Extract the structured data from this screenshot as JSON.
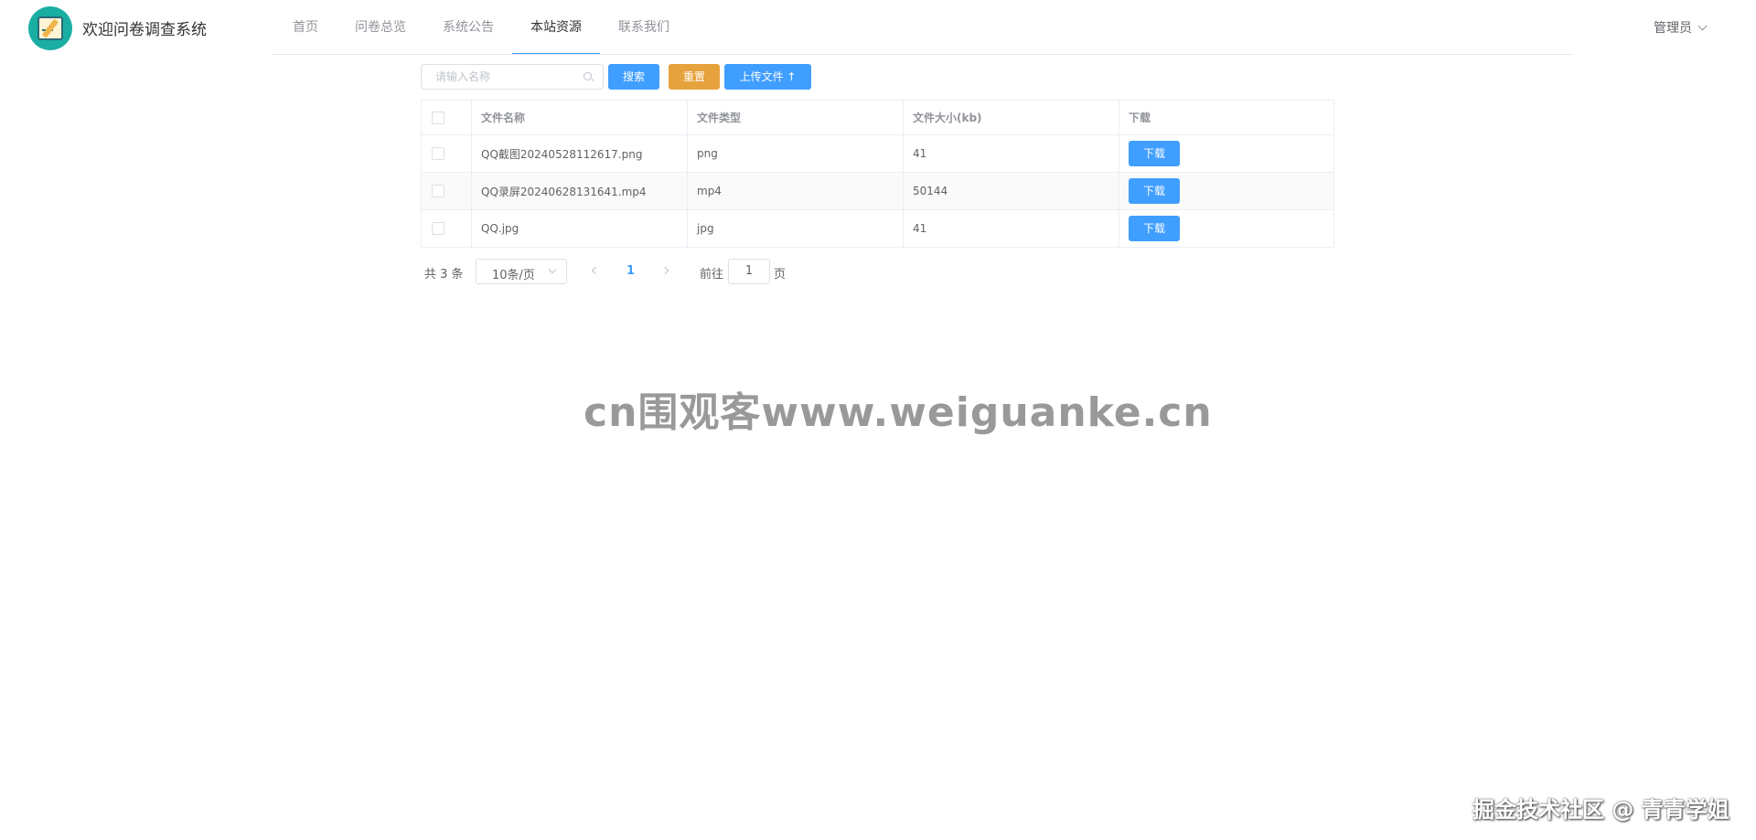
{
  "app": {
    "title": "欢迎问卷调查系统",
    "brand_color": "#1aaea3",
    "accent_color": "#409eff"
  },
  "nav": {
    "items": [
      {
        "label": "首页",
        "active": false
      },
      {
        "label": "问卷总览",
        "active": false
      },
      {
        "label": "系统公告",
        "active": false
      },
      {
        "label": "本站资源",
        "active": true
      },
      {
        "label": "联系我们",
        "active": false
      }
    ]
  },
  "user": {
    "label": "管理员",
    "icon": "chevron-down-icon"
  },
  "toolbar": {
    "search_placeholder": "请输入名称",
    "search_value": "",
    "search_label": "搜索",
    "reset_label": "重置",
    "upload_label": "上传文件 ↑",
    "reset_color": "#e6a23c"
  },
  "table": {
    "columns": [
      "文件名称",
      "文件类型",
      "文件大小(kb)",
      "下载"
    ],
    "rows": [
      {
        "name": "QQ截图20240528112617.png",
        "type": "png",
        "size": "41",
        "action": "下载"
      },
      {
        "name": "QQ录屏20240628131641.mp4",
        "type": "mp4",
        "size": "50144",
        "action": "下载"
      },
      {
        "name": "QQ.jpg",
        "type": "jpg",
        "size": "41",
        "action": "下载"
      }
    ]
  },
  "pagination": {
    "total_text": "共 3 条",
    "page_size": "10条/页",
    "current_page": "1",
    "goto_label": "前往",
    "goto_value": "1",
    "page_suffix": "页"
  },
  "watermarks": {
    "center": "cn围观客www.weiguanke.cn",
    "corner": "掘金技术社区 @ 青青学姐"
  }
}
